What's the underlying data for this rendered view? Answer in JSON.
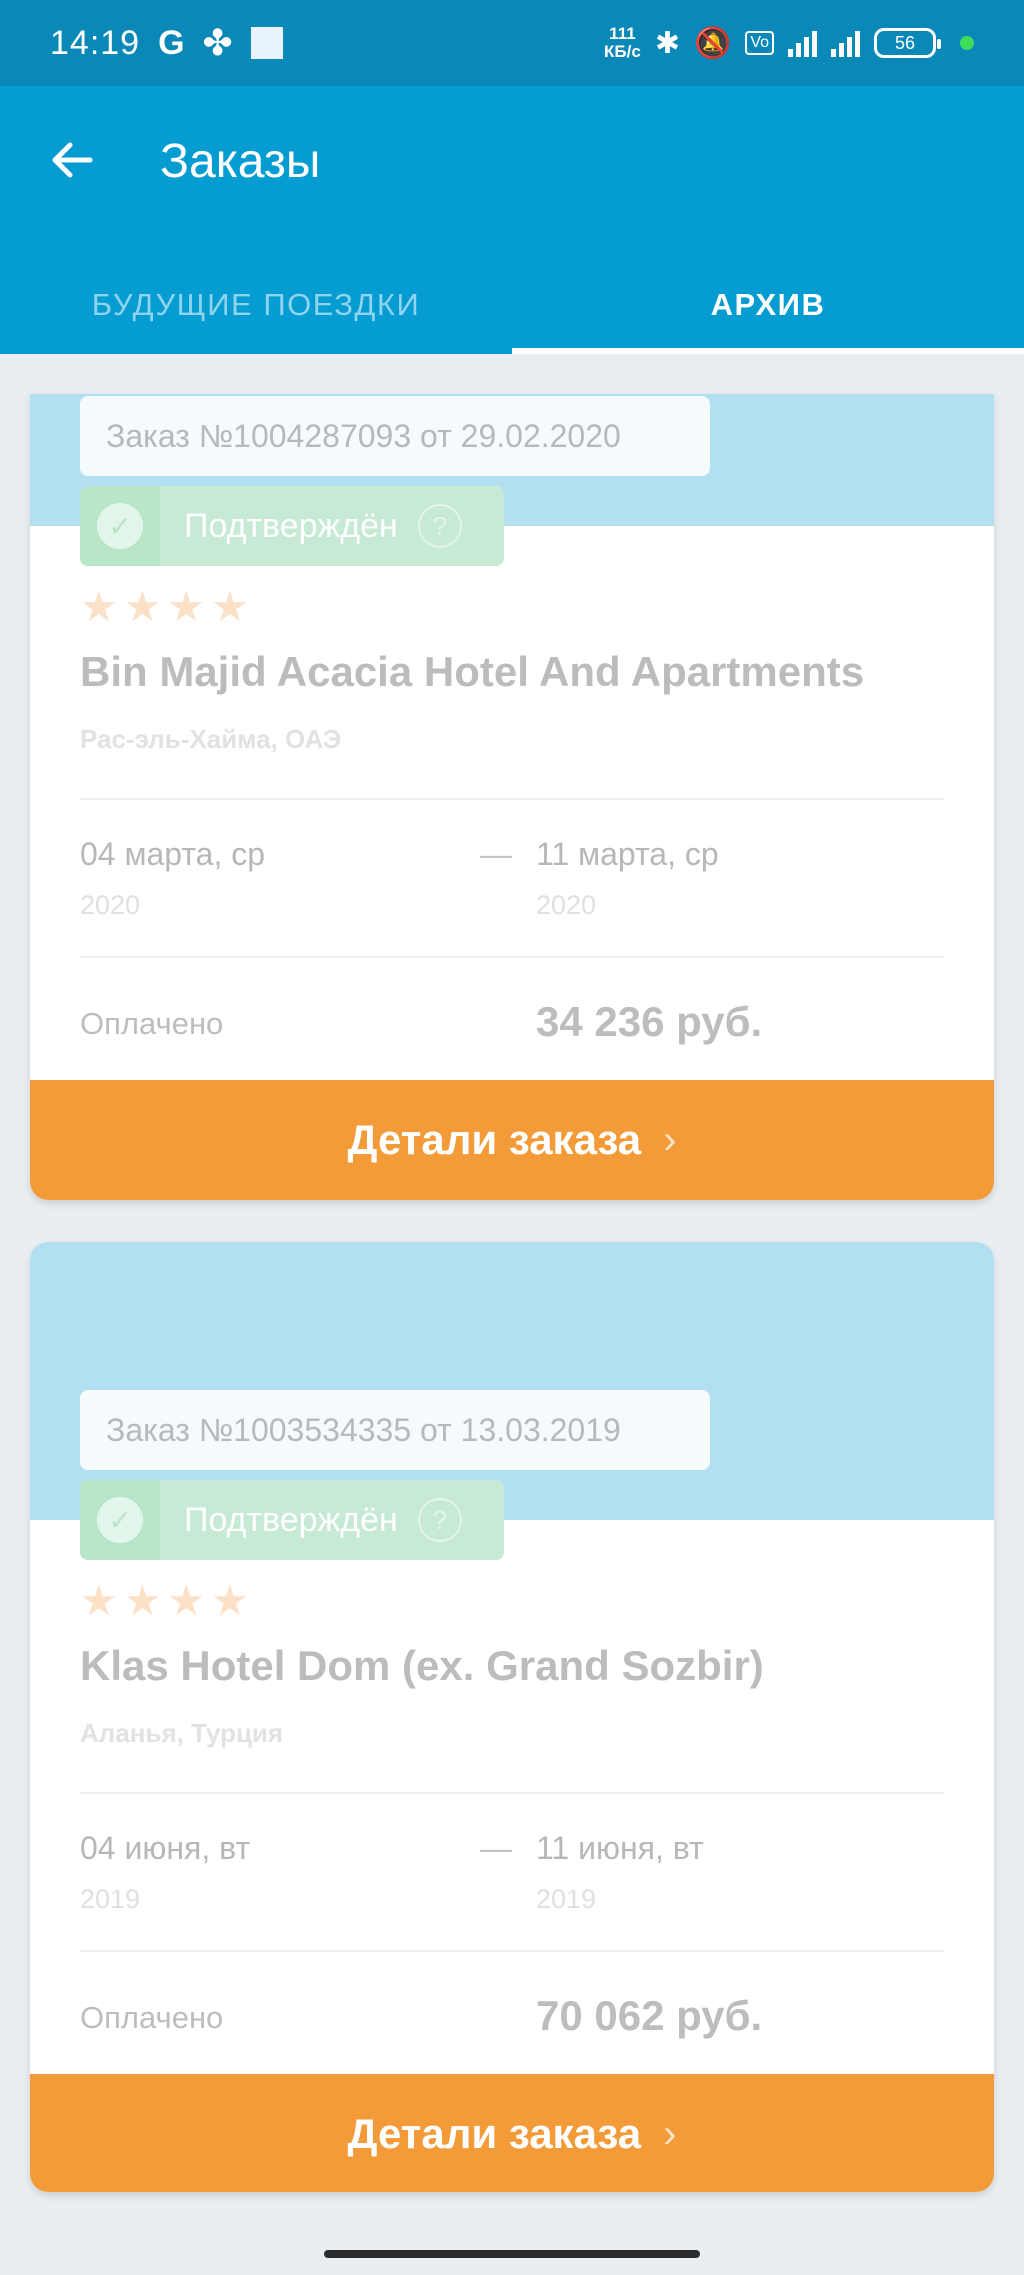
{
  "status_bar": {
    "time": "14:19",
    "g_label": "G",
    "speed_value": "111",
    "speed_unit": "КБ/с",
    "battery": "56"
  },
  "app_bar": {
    "title": "Заказы",
    "tabs": [
      {
        "label": "БУДУЩИЕ ПОЕЗДКИ"
      },
      {
        "label": "АРХИВ"
      }
    ]
  },
  "orders": [
    {
      "order_label": "Заказ №1004287093 от 29.02.2020",
      "status": "Подтверждён",
      "stars": 4,
      "hotel": "Bin Majid Acacia Hotel And Apartments",
      "location": "Рас-эль-Хайма, ОАЭ",
      "checkin_date": "04 марта, ср",
      "checkin_year": "2020",
      "checkout_date": "11 марта, ср",
      "checkout_year": "2020",
      "paid_label": "Оплачено",
      "amount": "34 236 руб.",
      "button": "Детали заказа"
    },
    {
      "order_label": "Заказ №1003534335 от 13.03.2019",
      "status": "Подтверждён",
      "stars": 4,
      "hotel": "Klas Hotel Dom (ex. Grand Sozbir)",
      "location": "Аланья, Турция",
      "checkin_date": "04 июня, вт",
      "checkin_year": "2019",
      "checkout_date": "11 июня, вт",
      "checkout_year": "2019",
      "paid_label": "Оплачено",
      "amount": "70 062 руб.",
      "button": "Детали заказа"
    }
  ],
  "colors": {
    "status_bar": "#0a89b8",
    "app_bar": "#059cd2",
    "banner": "#b3e0f0",
    "button": "#f29b38",
    "status_pill": "#c6ead3"
  }
}
